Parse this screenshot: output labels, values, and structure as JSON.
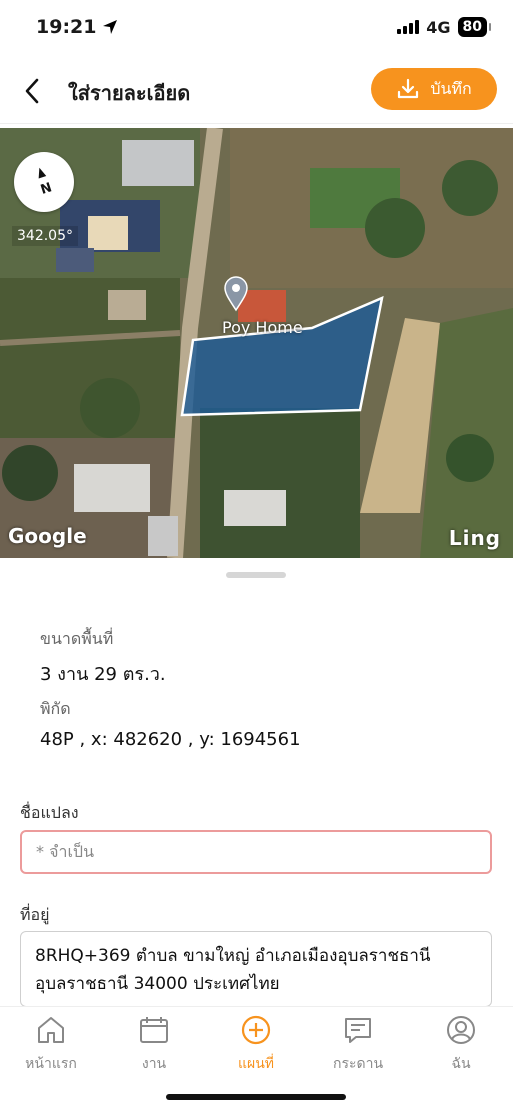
{
  "status": {
    "time": "19:21",
    "network": "4G",
    "battery": "80"
  },
  "header": {
    "title": "ใส่รายละเอียด",
    "save_label": "บันทึก"
  },
  "map": {
    "heading": "342.05°",
    "place_label": "Poy Home",
    "provider": "Google",
    "brand": "Ling",
    "compass_label": "N"
  },
  "info": {
    "area_label": "ขนาดพื้นที่",
    "area_value": "3 งาน  29 ตร.ว.",
    "coord_label": "พิกัด",
    "coord_value": "48P , x: 482620 , y: 1694561"
  },
  "form": {
    "name_label": "ชื่อแปลง",
    "name_placeholder": "* จำเป็น",
    "address_label": "ที่อยู่",
    "address_line1": "8RHQ+369 ตำบล ขามใหญ่ อำเภอเมืองอุบลราชธานี",
    "address_line2": "อุบลราชธานี 34000 ประเทศไทย"
  },
  "tabs": [
    {
      "label": "หน้าแรก",
      "icon": "home-icon"
    },
    {
      "label": "งาน",
      "icon": "calendar-icon"
    },
    {
      "label": "แผนที่",
      "icon": "plus-circle-icon"
    },
    {
      "label": "กระดาน",
      "icon": "board-icon"
    },
    {
      "label": "ฉัน",
      "icon": "profile-icon"
    }
  ],
  "colors": {
    "accent": "#f7931e",
    "polygon": "#1f5c96",
    "required_border": "#ec9b9b"
  }
}
